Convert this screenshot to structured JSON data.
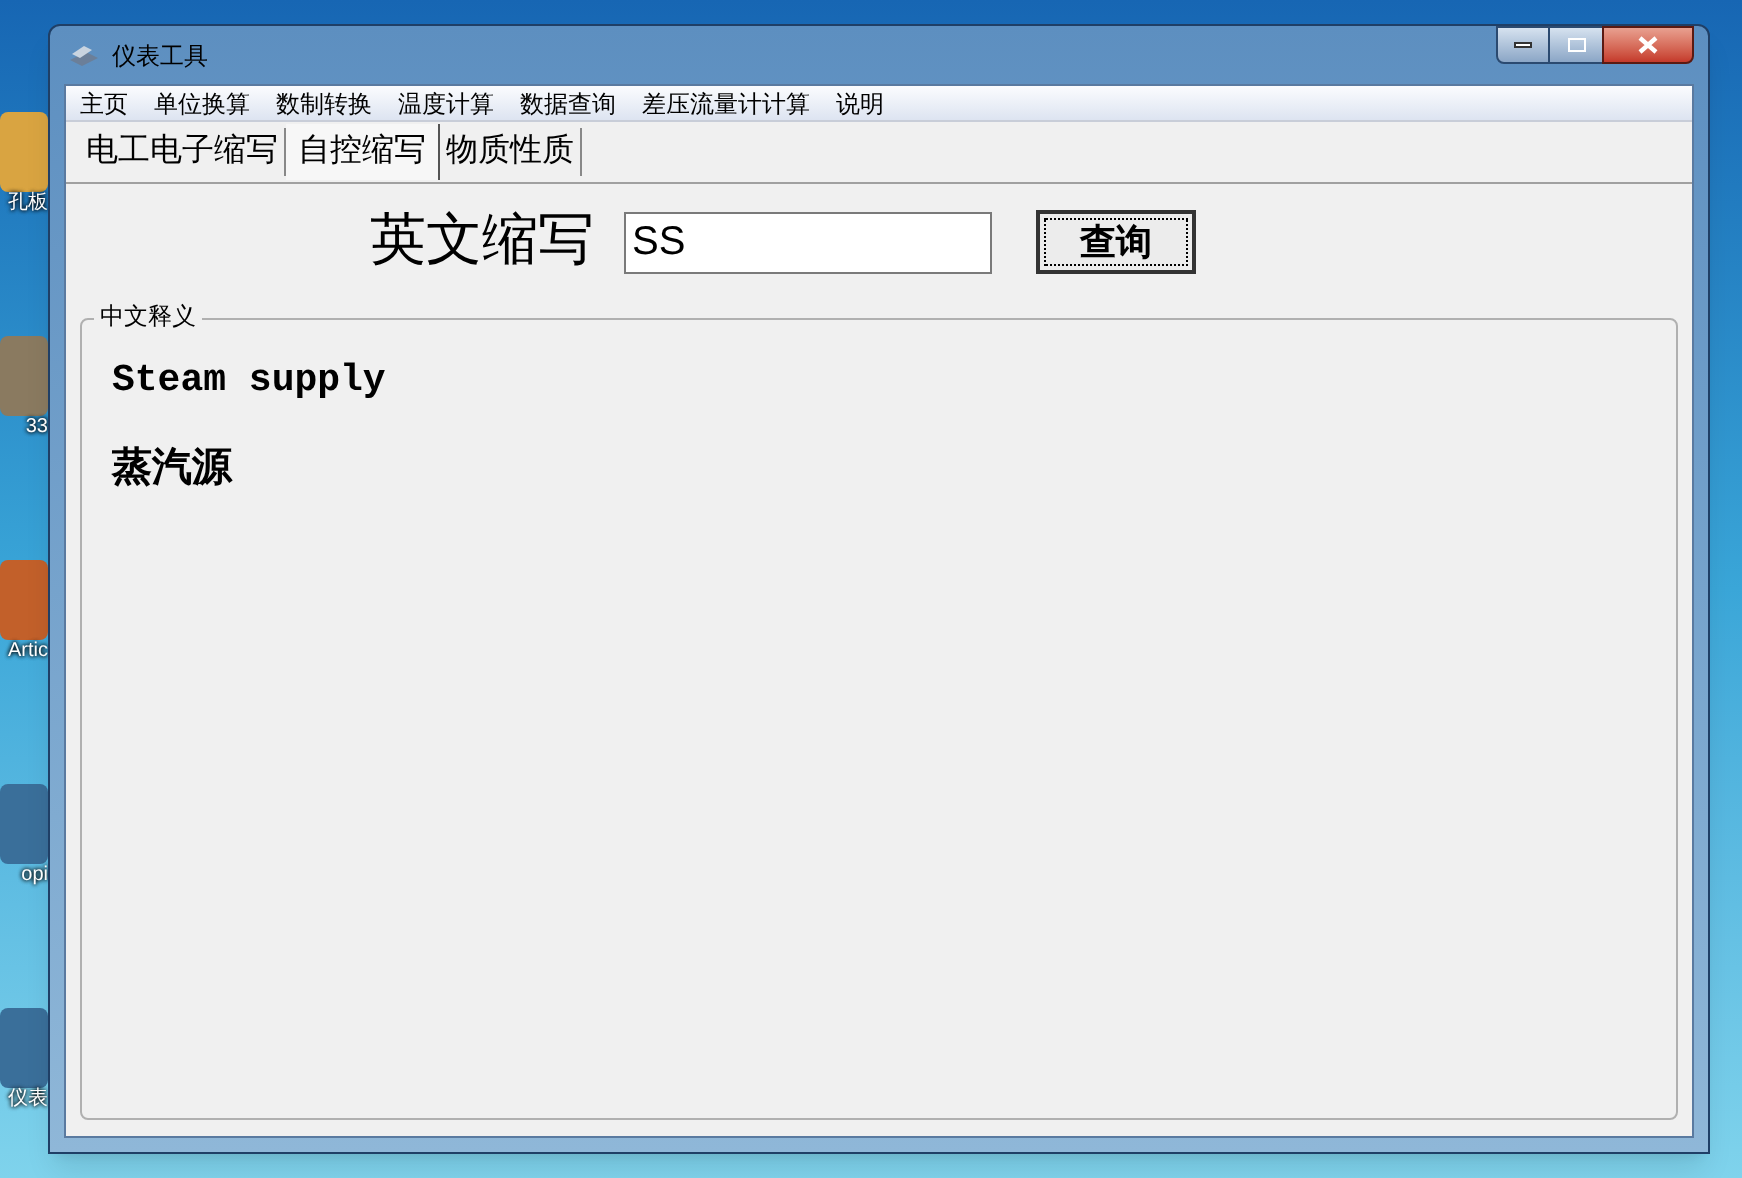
{
  "desktop": {
    "icons": [
      {
        "label": "孔板"
      },
      {
        "label": "33"
      },
      {
        "label": "Artic"
      },
      {
        "label": "opi"
      },
      {
        "label": "仪表"
      }
    ]
  },
  "window": {
    "title": "仪表工具"
  },
  "menu": [
    "主页",
    "单位换算",
    "数制转换",
    "温度计算",
    "数据查询",
    "差压流量计计算",
    "说明"
  ],
  "tabs": [
    {
      "label": "电工电子缩写",
      "selected": false
    },
    {
      "label": "自控缩写",
      "selected": true
    },
    {
      "label": "物质性质",
      "selected": false
    }
  ],
  "query": {
    "label": "英文缩写",
    "value": "SS",
    "button": "查询"
  },
  "result": {
    "title": "中文释义",
    "english": "Steam supply",
    "chinese": "蒸汽源"
  }
}
